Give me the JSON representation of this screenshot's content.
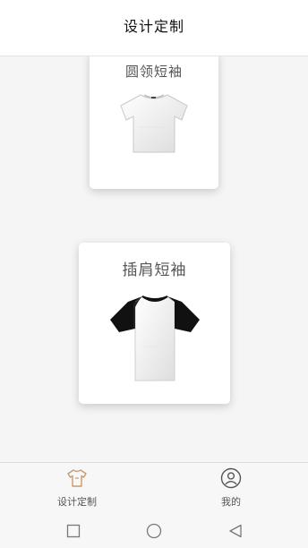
{
  "header": {
    "title": "设计定制"
  },
  "products": [
    {
      "title": "圆领短袖",
      "icon": "crew-neck-tshirt-image"
    },
    {
      "title": "插肩短袖",
      "icon": "raglan-tshirt-image"
    }
  ],
  "tabbar": {
    "items": [
      {
        "label": "设计定制",
        "icon": "tshirt-icon",
        "active": true,
        "color": "#c89a6e"
      },
      {
        "label": "我的",
        "icon": "user-icon",
        "active": false,
        "color": "#666666"
      }
    ]
  },
  "navbar": {
    "buttons": [
      "recent-apps-icon",
      "home-icon",
      "back-icon"
    ]
  }
}
